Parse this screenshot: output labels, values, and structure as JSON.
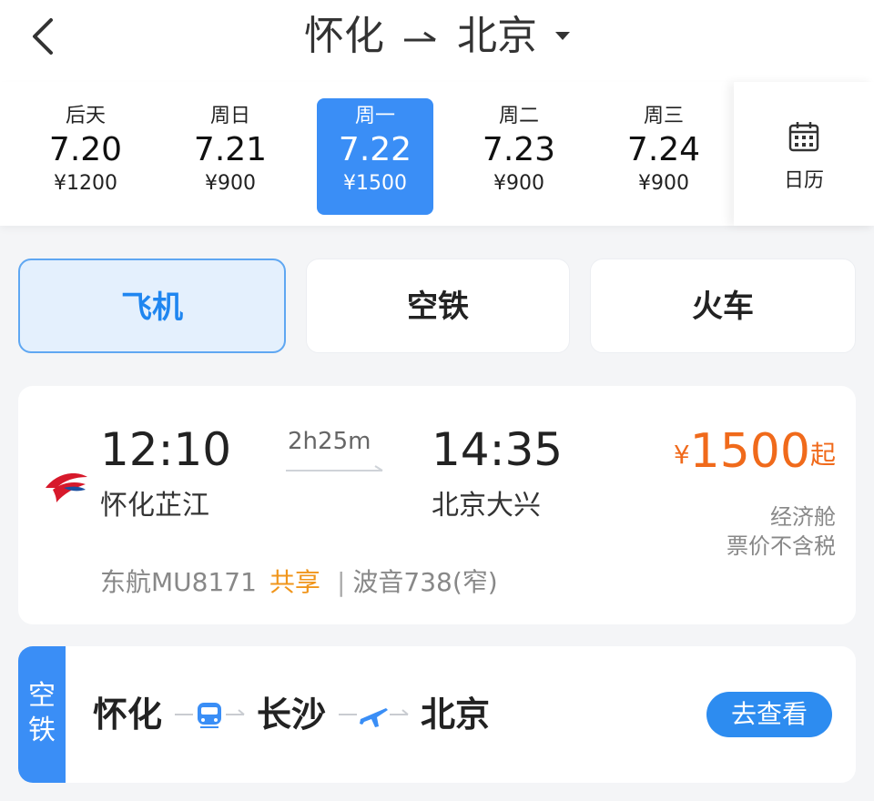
{
  "header": {
    "from": "怀化",
    "to": "北京",
    "arrow_icon": "route-arrow-icon",
    "back_icon": "chevron-left-icon",
    "dropdown_icon": "caret-down-icon"
  },
  "dates": [
    {
      "weekday": "后天",
      "date": "7.20",
      "price": "¥1200",
      "active": false
    },
    {
      "weekday": "周日",
      "date": "7.21",
      "price": "¥900",
      "active": false
    },
    {
      "weekday": "周一",
      "date": "7.22",
      "price": "¥1500",
      "active": true
    },
    {
      "weekday": "周二",
      "date": "7.23",
      "price": "¥900",
      "active": false
    },
    {
      "weekday": "周三",
      "date": "7.24",
      "price": "¥900",
      "active": false
    }
  ],
  "calendar": {
    "label": "日历",
    "icon": "calendar-icon"
  },
  "tabs": [
    {
      "label": "飞机",
      "active": true
    },
    {
      "label": "空铁",
      "active": false
    },
    {
      "label": "火车",
      "active": false
    }
  ],
  "flight": {
    "dep_time": "12:10",
    "arr_time": "14:35",
    "duration": "2h25m",
    "dep_airport": "怀化芷江",
    "arr_airport": "北京大兴",
    "currency": "¥",
    "price": "1500",
    "price_suffix": "起",
    "cabin": "经济舱",
    "tax_note": "票价不含税",
    "flight_no": "东航MU8171",
    "share": "共享",
    "separator": "|",
    "aircraft": "波音738(窄)",
    "airline_icon": "china-eastern-logo-icon"
  },
  "rail_air": {
    "tag": [
      "空",
      "铁"
    ],
    "cities": [
      "怀化",
      "长沙",
      "北京"
    ],
    "legs": [
      "train-icon",
      "plane-icon"
    ],
    "button": "去查看"
  },
  "colors": {
    "accent": "#3a8ef6",
    "price": "#f06a1b",
    "share": "#f0951b",
    "tab_active_bg": "#e4f0fd"
  }
}
